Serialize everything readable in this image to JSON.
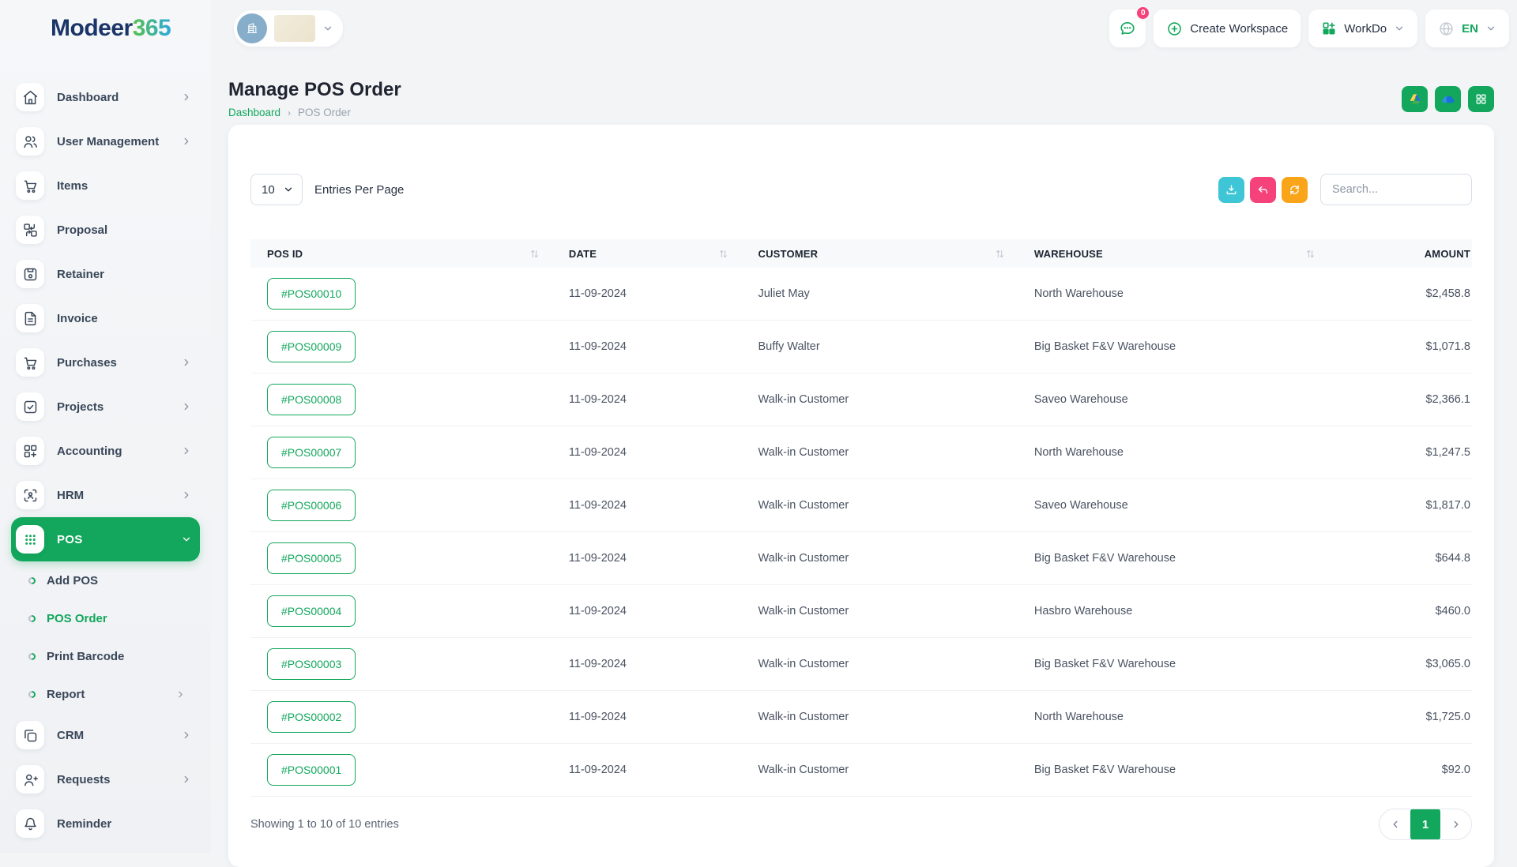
{
  "brand": {
    "logo_primary": "Modeer",
    "logo_suffix": "365"
  },
  "topbar": {
    "notification_count": "0",
    "create_workspace_label": "Create Workspace",
    "workdo_label": "WorkDo",
    "language_label": "EN",
    "icons": [
      "chat-bubble-icon",
      "circle-plus-icon",
      "grid-plus-icon",
      "globe-icon",
      "chevron-down-icon"
    ]
  },
  "sidebar": {
    "items": [
      {
        "label": "Dashboard",
        "icon": "home-icon",
        "has_chevron": true
      },
      {
        "label": "User Management",
        "icon": "users-icon",
        "has_chevron": true
      },
      {
        "label": "Items",
        "icon": "cart-icon",
        "has_chevron": false
      },
      {
        "label": "Proposal",
        "icon": "swap-boxes-icon",
        "has_chevron": false
      },
      {
        "label": "Retainer",
        "icon": "save-icon",
        "has_chevron": false
      },
      {
        "label": "Invoice",
        "icon": "file-text-icon",
        "has_chevron": false
      },
      {
        "label": "Purchases",
        "icon": "cart-icon",
        "has_chevron": true
      },
      {
        "label": "Projects",
        "icon": "check-square-icon",
        "has_chevron": true
      },
      {
        "label": "Accounting",
        "icon": "grid-plus-icon",
        "has_chevron": true
      },
      {
        "label": "HRM",
        "icon": "user-scan-icon",
        "has_chevron": true
      },
      {
        "label": "POS",
        "icon": "dots-grid-icon",
        "has_chevron": true,
        "active": true
      },
      {
        "label": "CRM",
        "icon": "copy-icon",
        "has_chevron": true
      },
      {
        "label": "Requests",
        "icon": "user-plus-icon",
        "has_chevron": true
      },
      {
        "label": "Reminder",
        "icon": "bell-icon",
        "has_chevron": false
      }
    ],
    "pos_submenu": [
      {
        "label": "Add POS",
        "active": false
      },
      {
        "label": "POS Order",
        "active": true
      },
      {
        "label": "Print Barcode",
        "active": false
      },
      {
        "label": "Report",
        "active": false,
        "has_chevron": true
      }
    ]
  },
  "page": {
    "title": "Manage POS Order",
    "breadcrumb": [
      "Dashboard",
      "POS Order"
    ],
    "header_actions": [
      "google-drive-icon",
      "onedrive-icon",
      "grid-icon"
    ]
  },
  "controls": {
    "entries_value": "10",
    "entries_label": "Entries Per Page",
    "search_placeholder": "Search...",
    "action_icons": [
      "download-icon",
      "undo-icon",
      "refresh-icon"
    ]
  },
  "table": {
    "columns": [
      "POS ID",
      "DATE",
      "CUSTOMER",
      "WAREHOUSE",
      "AMOUNT"
    ],
    "rows": [
      {
        "pos_id": "#POS00010",
        "date": "11-09-2024",
        "customer": "Juliet May",
        "warehouse": "North Warehouse",
        "amount": "$2,458.8"
      },
      {
        "pos_id": "#POS00009",
        "date": "11-09-2024",
        "customer": "Buffy Walter",
        "warehouse": "Big Basket F&V Warehouse",
        "amount": "$1,071.8"
      },
      {
        "pos_id": "#POS00008",
        "date": "11-09-2024",
        "customer": "Walk-in Customer",
        "warehouse": "Saveo Warehouse",
        "amount": "$2,366.1"
      },
      {
        "pos_id": "#POS00007",
        "date": "11-09-2024",
        "customer": "Walk-in Customer",
        "warehouse": "North Warehouse",
        "amount": "$1,247.5"
      },
      {
        "pos_id": "#POS00006",
        "date": "11-09-2024",
        "customer": "Walk-in Customer",
        "warehouse": "Saveo Warehouse",
        "amount": "$1,817.0"
      },
      {
        "pos_id": "#POS00005",
        "date": "11-09-2024",
        "customer": "Walk-in Customer",
        "warehouse": "Big Basket F&V Warehouse",
        "amount": "$644.8"
      },
      {
        "pos_id": "#POS00004",
        "date": "11-09-2024",
        "customer": "Walk-in Customer",
        "warehouse": "Hasbro Warehouse",
        "amount": "$460.0"
      },
      {
        "pos_id": "#POS00003",
        "date": "11-09-2024",
        "customer": "Walk-in Customer",
        "warehouse": "Big Basket F&V Warehouse",
        "amount": "$3,065.0"
      },
      {
        "pos_id": "#POS00002",
        "date": "11-09-2024",
        "customer": "Walk-in Customer",
        "warehouse": "North Warehouse",
        "amount": "$1,725.0"
      },
      {
        "pos_id": "#POS00001",
        "date": "11-09-2024",
        "customer": "Walk-in Customer",
        "warehouse": "Big Basket F&V Warehouse",
        "amount": "$92.0"
      }
    ],
    "footer_text": "Showing 1 to 10 of 10 entries",
    "page_number": "1"
  },
  "colors": {
    "brand_green": "#12A75C",
    "badge_pink": "#F5427B",
    "download_teal": "#3EC6D6",
    "undo_pink": "#F5427B",
    "refresh_orange": "#FAA41A",
    "logo_navy": "#1C3568",
    "drive_yellow": "#FFD14D",
    "drive_blue": "#2D6BD8",
    "onedrive_blue": "#1B70D6"
  }
}
